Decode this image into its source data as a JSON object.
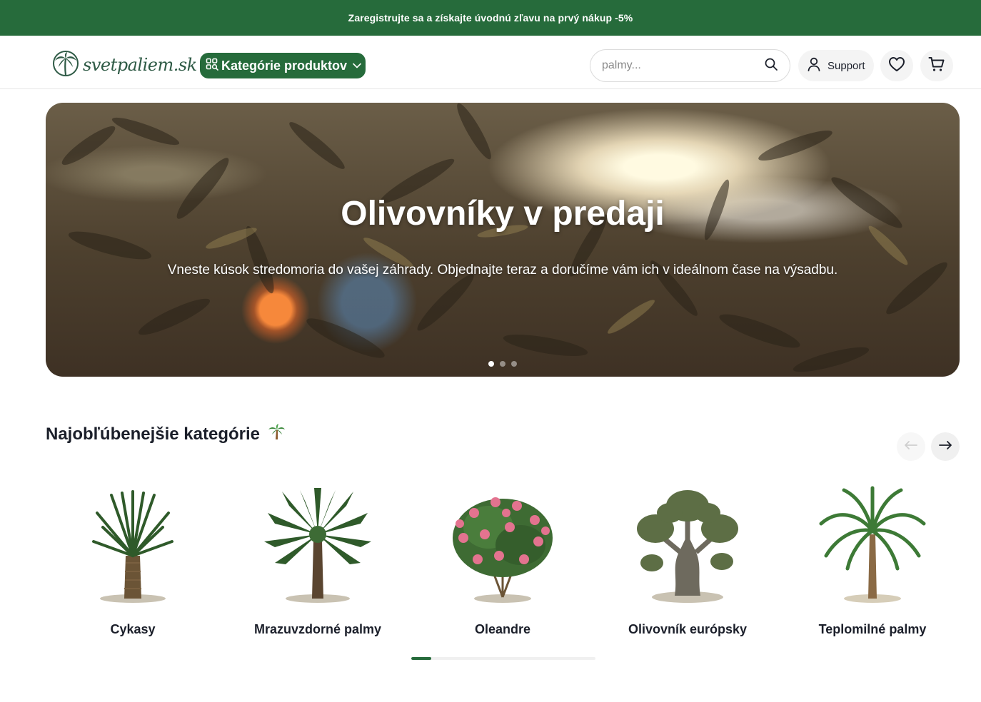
{
  "promo": {
    "text": "Zaregistrujte sa a získajte úvodnú zľavu na prvý nákup -5%"
  },
  "header": {
    "logo_text": "svetpaliem.sk",
    "categories_button": "Kategórie produktov",
    "search": {
      "placeholder": "palmy...",
      "value": ""
    },
    "support_label": "Support"
  },
  "icons": {
    "logo": "palm-logo-icon",
    "categories": "category-search-icon",
    "chevron": "chevron-down-icon",
    "search": "search-icon",
    "user": "user-icon",
    "wishlist": "heart-icon",
    "cart": "cart-icon",
    "prev": "arrow-left-icon",
    "next": "arrow-right-icon"
  },
  "hero": {
    "title": "Olivovníky v predaji",
    "subtitle": "Vneste kúsok stredomoria do vašej záhrady. Objednajte teraz a doručíme vám ich v ideálnom čase na výsadbu.",
    "slides_total": 3,
    "active_slide": 1
  },
  "section": {
    "title": "Najobľúbenejšie kategórie",
    "emoji": "🌴"
  },
  "categories": [
    {
      "name": "Cykasy"
    },
    {
      "name": "Mrazuvzdorné palmy"
    },
    {
      "name": "Oleandre"
    },
    {
      "name": "Olivovník európsky"
    },
    {
      "name": "Teplomilné palmy"
    }
  ],
  "carousel_progress": 0.11,
  "colors": {
    "brand": "#266b3b",
    "text": "#1b1f2a"
  }
}
